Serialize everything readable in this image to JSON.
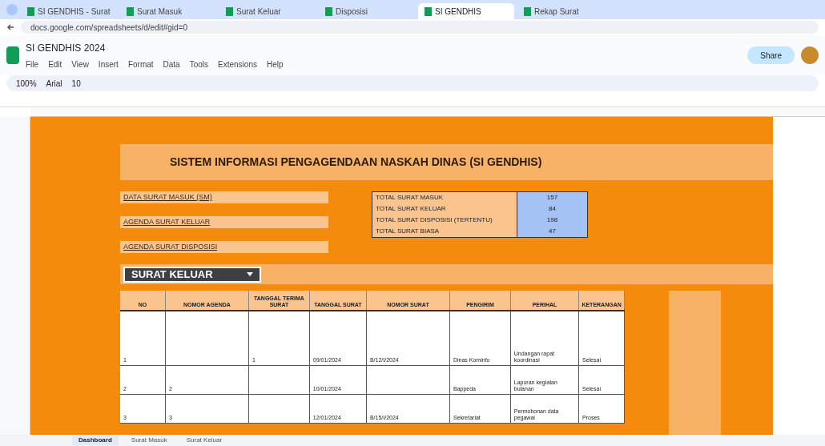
{
  "browser": {
    "tabs": [
      {
        "label": "SI GENDHIS - Surat",
        "selected": false
      },
      {
        "label": "Surat Masuk",
        "selected": false
      },
      {
        "label": "Surat Keluar",
        "selected": false
      },
      {
        "label": "Disposisi",
        "selected": false
      },
      {
        "label": "SI GENDHIS",
        "selected": true
      },
      {
        "label": "Rekap Surat",
        "selected": false
      }
    ],
    "url": "docs.google.com/spreadsheets/d/edit#gid=0"
  },
  "sheet": {
    "title": "SI GENDHIS 2024",
    "menus": [
      "File",
      "Edit",
      "View",
      "Insert",
      "Format",
      "Data",
      "Tools",
      "Extensions",
      "Help"
    ],
    "share": "Share",
    "zoom": "100%",
    "font": "Arial",
    "font_size": "10"
  },
  "title": "SISTEM INFORMASI PENGAGENDAAN NASKAH DINAS (SI GENDHIS)",
  "links": [
    "DATA SURAT MASUK (SM)",
    "AGENDA SURAT KELUAR",
    "AGENDA SURAT DISPOSISI"
  ],
  "totals": [
    {
      "label": "TOTAL SURAT MASUK",
      "value": "157"
    },
    {
      "label": "TOTAL SURAT KELUAR",
      "value": "84"
    },
    {
      "label": "TOTAL SURAT DISPOSISI (TERTENTU)",
      "value": "198"
    },
    {
      "label": "TOTAL SURAT BIASA",
      "value": "47"
    }
  ],
  "filter": "SURAT KELUAR",
  "table": {
    "columns": [
      "NO",
      "NOMOR AGENDA",
      "TANGGAL TERIMA SURAT",
      "TANGGAL SURAT",
      "NOMOR SURAT",
      "PENGIRIM",
      "PERIHAL",
      "KETERANGAN"
    ],
    "rows": [
      [
        "1",
        "",
        "1",
        "09/01/2024",
        "B/12/I/2024",
        "Dinas Kominfo",
        "Undangan rapat koordinasi",
        "Selesai"
      ],
      [
        "2",
        "2",
        "",
        "10/01/2024",
        "",
        "Bappeda",
        "Laporan kegiatan bulanan",
        "Selesai"
      ],
      [
        "3",
        "3",
        "",
        "12/01/2024",
        "B/15/I/2024",
        "Sekretariat",
        "Permohonan data pegawai",
        "Proses"
      ]
    ]
  },
  "sheet_tabs": [
    {
      "label": "Dashboard",
      "selected": true
    },
    {
      "label": "Surat Masuk",
      "selected": false
    },
    {
      "label": "Surat Keluar",
      "selected": false
    }
  ]
}
